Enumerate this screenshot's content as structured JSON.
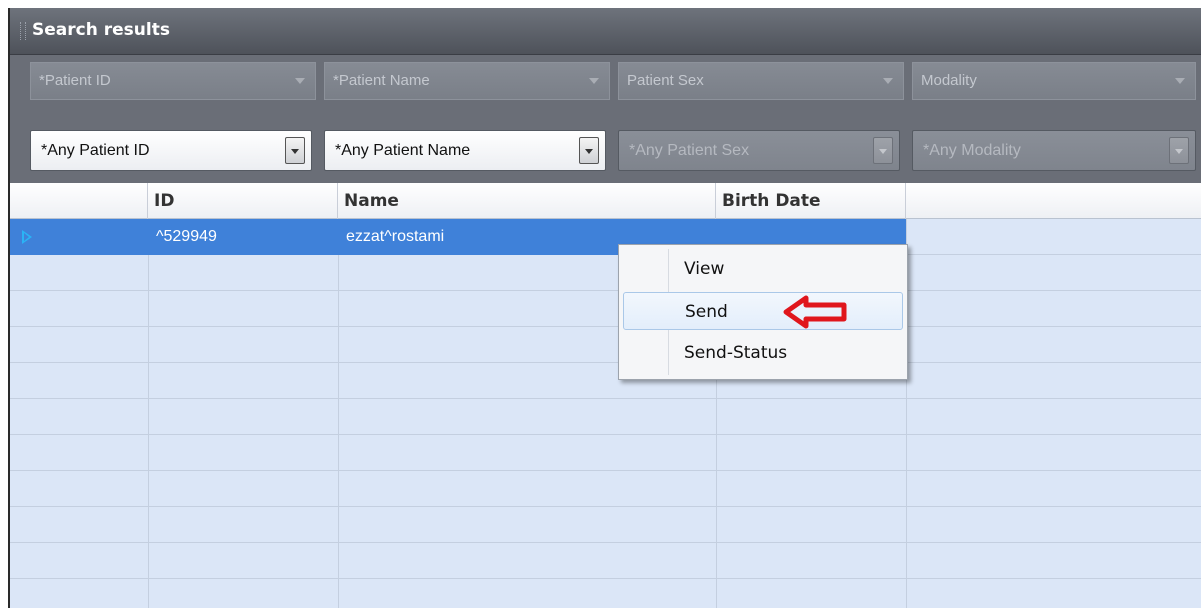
{
  "window": {
    "title": "Search results"
  },
  "filters": {
    "columns": [
      {
        "label": "*Patient ID",
        "value": "*Any Patient ID",
        "enabled": true
      },
      {
        "label": "*Patient Name",
        "value": "*Any Patient Name",
        "enabled": true
      },
      {
        "label": "Patient Sex",
        "value": "*Any Patient Sex",
        "enabled": false
      },
      {
        "label": "Modality",
        "value": "*Any Modality",
        "enabled": false
      }
    ]
  },
  "grid": {
    "headers": [
      "",
      "ID",
      "Name",
      "Birth Date",
      ""
    ],
    "rows": [
      {
        "id": "^529949",
        "name": "ezzat^rostami",
        "birth_date": "",
        "selected": true
      }
    ]
  },
  "context_menu": {
    "items": [
      {
        "label": "View"
      },
      {
        "label": "Send",
        "hovered": true
      },
      {
        "label": "Send-Status"
      }
    ]
  },
  "colors": {
    "selection": "#3f81d9",
    "grid_bg": "#dbe6f7",
    "annotation_arrow": "#e0161c"
  }
}
